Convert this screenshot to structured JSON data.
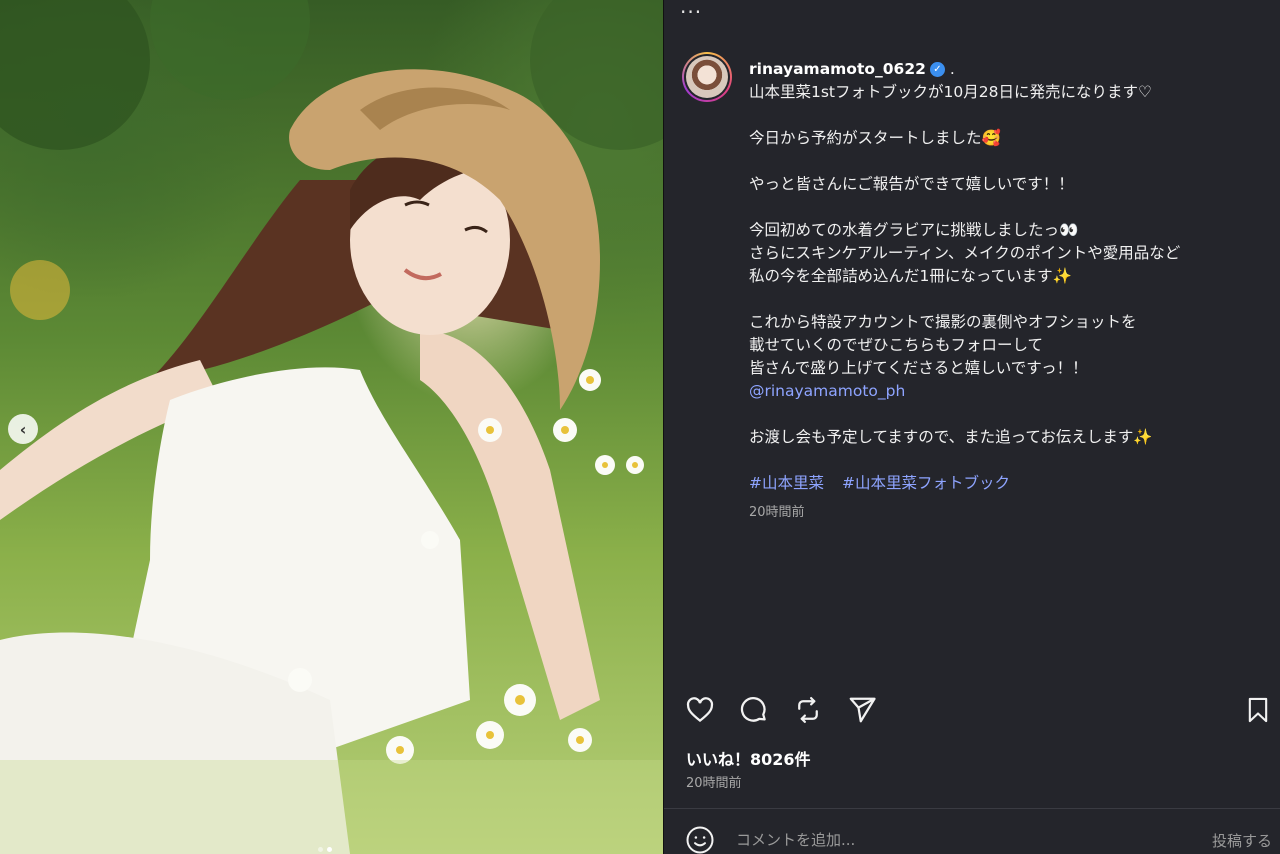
{
  "photo": {
    "prev_glyph": "‹",
    "slide_count": 2,
    "active_slide": 2
  },
  "panel": {
    "more_label": "...",
    "author": {
      "username": "rinayamamoto_0622",
      "verified_glyph": "✓",
      "separator": "."
    },
    "caption_lines": [
      "山本里菜1stフォトブックが10月28日に発売になります♡",
      "",
      "今日から予約がスタートしました🥰",
      "",
      "やっと皆さんにご報告ができて嬉しいです！！",
      "",
      "今回初めての水着グラビアに挑戦しましたっ👀",
      "さらにスキンケアルーティン、メイクのポイントや愛用品など",
      "私の今を全部詰め込んだ1冊になっています✨",
      "",
      "これから特設アカウントで撮影の裏側やオフショットを",
      "載せていくのでぜひこちらもフォローして",
      "皆さんで盛り上げてくださると嬉しいですっ！！"
    ],
    "mention": "@rinayamamoto_ph",
    "closing_line": "お渡し会も予定してますので、また追ってお伝えします✨",
    "hashtags": [
      "#山本里菜",
      "#山本里菜フォトブック"
    ],
    "caption_time": "20時間前",
    "likes": "いいね！8026件",
    "post_time": "20時間前",
    "comment": {
      "placeholder": "コメントを追加...",
      "post_label": "投稿する"
    },
    "icons": [
      "heart-icon",
      "comment-icon",
      "repost-icon",
      "share-icon",
      "bookmark-icon",
      "emoji-icon"
    ],
    "colors": {
      "link": "#8ea4ff",
      "verified": "#3b8fef",
      "background": "#24252b"
    }
  }
}
